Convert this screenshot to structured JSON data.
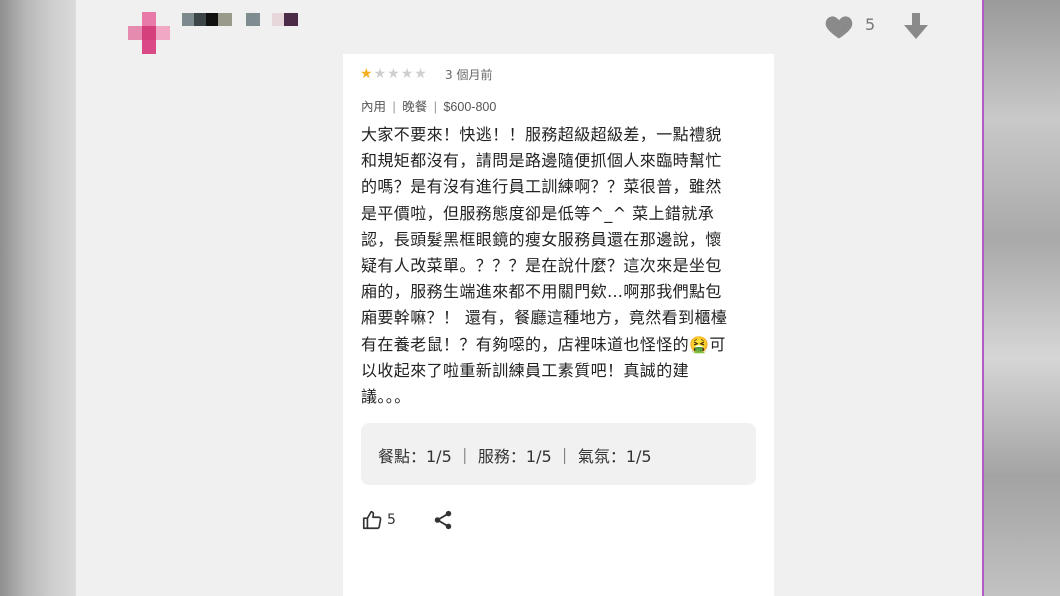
{
  "header": {
    "like_count": "5",
    "icons": {
      "like": "heart-icon",
      "downvote": "arrow-down-icon"
    },
    "colors": {
      "avatar_pink": "#d94a86",
      "icon_gray": "#8a8a8a"
    }
  },
  "review": {
    "star_rating": 1,
    "star_max": 5,
    "time_ago": "3 個月前",
    "meta": {
      "dining_type": "內用",
      "meal": "晚餐",
      "price_range": "$600-800",
      "separator": "|"
    },
    "body": "大家不要來！快逃！！服務超級超級差，一點禮貌\n和規矩都沒有，請問是路邊隨便抓個人來臨時幫忙\n的嗎？是有沒有進行員工訓練啊？？菜很普，雖然\n是平價啦，但服務態度卻是低等^_^ 菜上錯就承\n認，長頭髮黑框眼鏡的瘦女服務員還在那邊說，懷\n疑有人改菜單。？？？是在說什麼？這次來是坐包\n廂的，服務生端進來都不用關門欸…啊那我們點包\n廂要幹嘛？！ 還有，餐廳這種地方，竟然看到櫃檯\n有在養老鼠！？有夠噁的，店裡味道也怪怪的🤮可\n以收起來了啦重新訓練員工素質吧！真誠的建\n議。。。",
    "ratings_text": "餐點：1/5 ｜ 服務：1/5 ｜ 氣氛：1/5",
    "helpful_count": "5",
    "icons": {
      "helpful": "thumbs-up-icon",
      "share": "share-icon"
    },
    "colors": {
      "star_on": "#f2b01e",
      "star_off": "#cfcfcf"
    }
  }
}
